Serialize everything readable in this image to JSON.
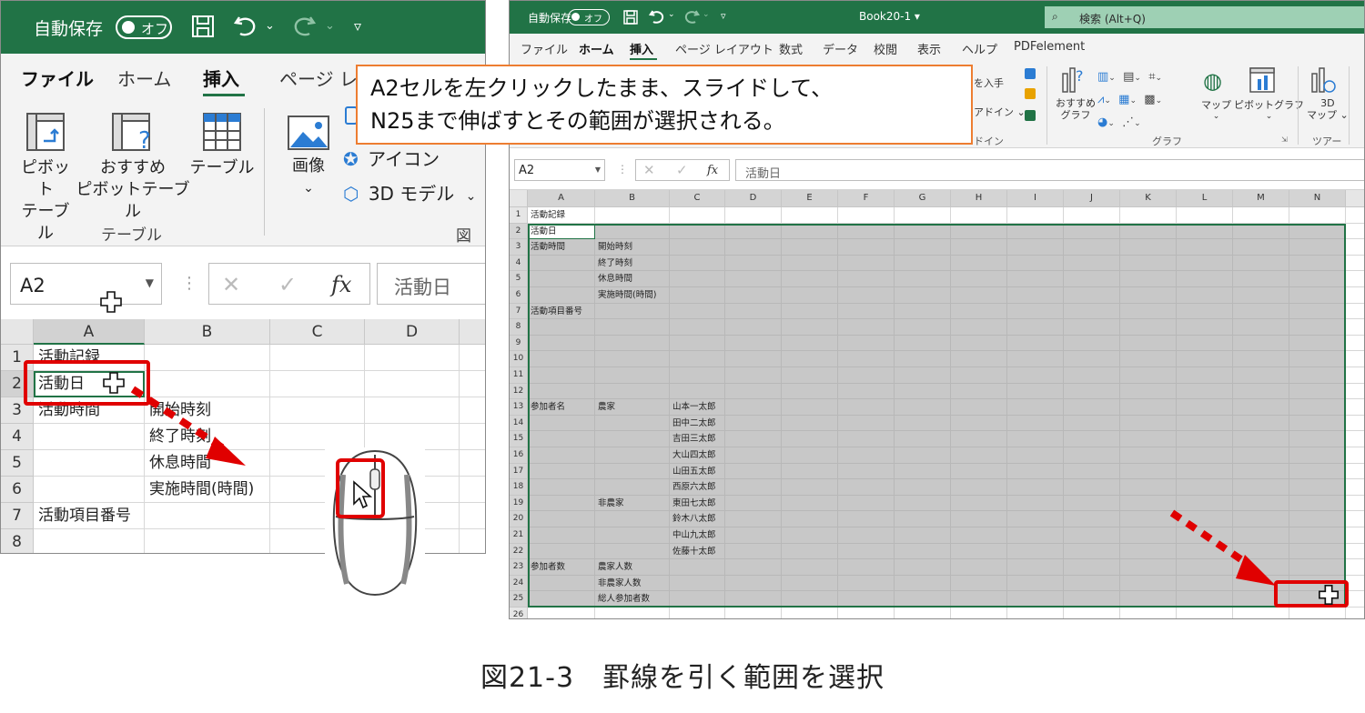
{
  "left": {
    "title": {
      "autosave": "自動保存",
      "toggle": "オフ"
    },
    "tabs": [
      "ファイル",
      "ホーム",
      "挿入",
      "ページ レ"
    ],
    "ribbon": {
      "pivot": [
        "ピボット",
        "テーブル"
      ],
      "recommended": [
        "おすすめ",
        "ピボットテーブル"
      ],
      "table": "テーブル",
      "image": "画像",
      "icon": "アイコン",
      "model3d": "3D モデル",
      "group_table": "テーブル",
      "group_figure": "図"
    },
    "namebox": "A2",
    "formula_value": "活動日",
    "columns": [
      "A",
      "B",
      "C",
      "D"
    ],
    "rows": [
      "1",
      "2",
      "3",
      "4",
      "5",
      "6",
      "7",
      "8"
    ],
    "cells": {
      "a1": "活動記録",
      "a2": "活動日",
      "a3": "活動時間",
      "b3": "開始時刻",
      "b4": "終了時刻",
      "b5": "休息時間",
      "b6": "実施時間(時間)",
      "a7": "活動項目番号"
    }
  },
  "right": {
    "title": {
      "autosave": "自動保存",
      "toggle": "オフ",
      "book": "Book20-1 ▾",
      "search": "検索 (Alt+Q)"
    },
    "tabs": [
      "ファイル",
      "ホーム",
      "挿入",
      "ページ レイアウト",
      "数式",
      "データ",
      "校閲",
      "表示",
      "ヘルプ",
      "PDFelement"
    ],
    "ribbon": {
      "addin_get": "を入手",
      "addin_mine": "アドイン ⌄",
      "addin_group": "ドイン",
      "recommended_chart": [
        "おすすめ",
        "グラフ"
      ],
      "map": "マップ",
      "pivot_chart": "ピボットグラフ",
      "map3d": [
        "3D",
        "マップ ⌄"
      ],
      "group_chart": "グラフ",
      "group_tour": "ツアー"
    },
    "namebox": "A2",
    "formula_value": "活動日",
    "columns": [
      "A",
      "B",
      "C",
      "D",
      "E",
      "F",
      "G",
      "H",
      "I",
      "J",
      "K",
      "L",
      "M",
      "N"
    ],
    "rows": [
      "1",
      "2",
      "3",
      "4",
      "5",
      "6",
      "7",
      "8",
      "9",
      "10",
      "11",
      "12",
      "13",
      "14",
      "15",
      "16",
      "17",
      "18",
      "19",
      "20",
      "21",
      "22",
      "23",
      "24",
      "25",
      "26"
    ],
    "cells": {
      "a1": "活動記録",
      "a2": "活動日",
      "a3": "活動時間",
      "b3": "開始時刻",
      "b4": "終了時刻",
      "b5": "休息時間",
      "b6": "実施時間(時間)",
      "a7": "活動項目番号",
      "a13": "参加者名",
      "b13": "農家",
      "c13": "山本一太郎",
      "c14": "田中二太郎",
      "c15": "吉田三太郎",
      "c16": "大山四太郎",
      "c17": "山田五太郎",
      "c18": "西原六太郎",
      "b19": "非農家",
      "c19": "東田七太郎",
      "c20": "鈴木八太郎",
      "c21": "中山九太郎",
      "c22": "佐藤十太郎",
      "a23": "参加者数",
      "b23": "農家人数",
      "b24": "非農家人数",
      "b25": "総人参加者数"
    }
  },
  "callout": [
    "A2セルを左クリックしたまま、スライドして、",
    "N25まで伸ばすとその範囲が選択される。"
  ],
  "caption": "図21-3　罫線を引く範囲を選択",
  "colors": {
    "excel_green": "#217346",
    "highlight_red": "#e00000",
    "callout_border": "#ed7d31",
    "selection_gray": "#c8c8c8"
  }
}
